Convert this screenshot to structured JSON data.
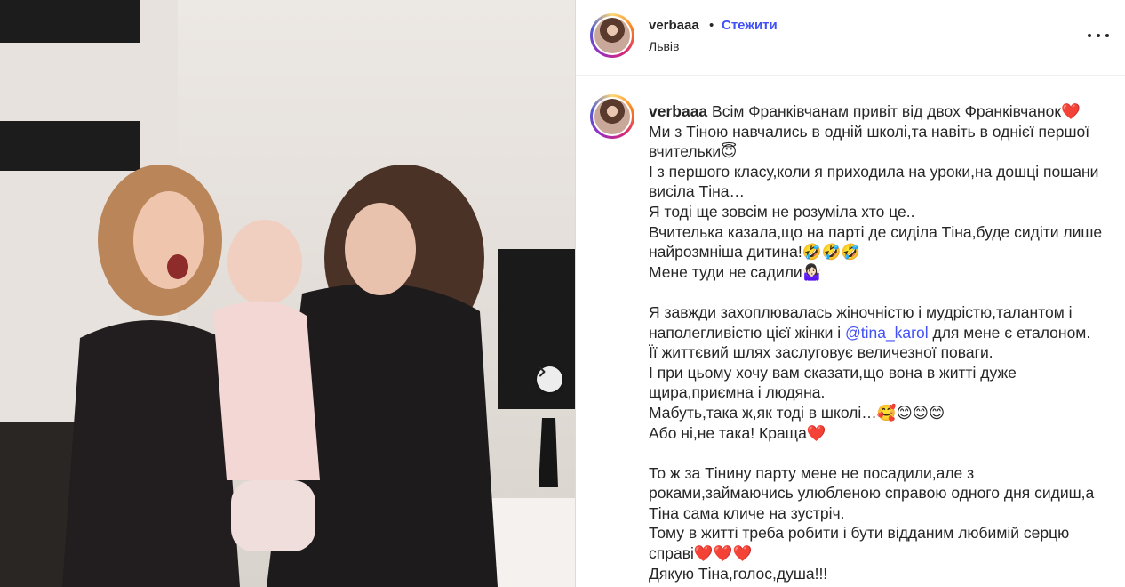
{
  "post": {
    "username": "verbaaa",
    "separator": "•",
    "follow_label": "Стежити",
    "location": "Львів",
    "next_icon": "chevron-right-icon",
    "more_icon": "more-horizontal-icon"
  },
  "caption": {
    "username": "verbaaa",
    "part1": " Всім Франківчанам привіт від двох Франківчанок❤️\nМи з Тіною навчались в одній школі,та навіть в однієї першої вчительки😇\nІ з першого класу,коли я приходила на уроки,на дошці пошани висіла Тіна…\nЯ тоді ще зовсім не розуміла хто це..\nВчителька казала,що на парті де сиділа Тіна,буде сидіти лише найрозмніша дитина!🤣🤣🤣\nМене туди не садили🤷🏻‍♀️\n\nЯ завжди захоплювалась жіночністю і мудрістю,талантом і наполегливістю цієї жінки і ",
    "mention": "@tina_karol",
    "part2": " для мене є еталоном.\nЇї життєвий шлях заслуговує величезної поваги.\nІ при цьому хочу вам сказати,що вона в житті дуже щира,приємна і людяна.\nМабуть,така ж,як тоді в школі…🥰😊😊😊\nАбо ні,не така! Краща❤️\n\nТо ж за Тінину парту мене не посадили,але з роками,займаючись улюбленою справою одного дня сидиш,а Тіна сама кличе на зустріч.\nТому в житті треба робити і бути відданим любимій серцю справі❤️❤️❤️\nДякую Тіна,голос,душа!!!"
  }
}
